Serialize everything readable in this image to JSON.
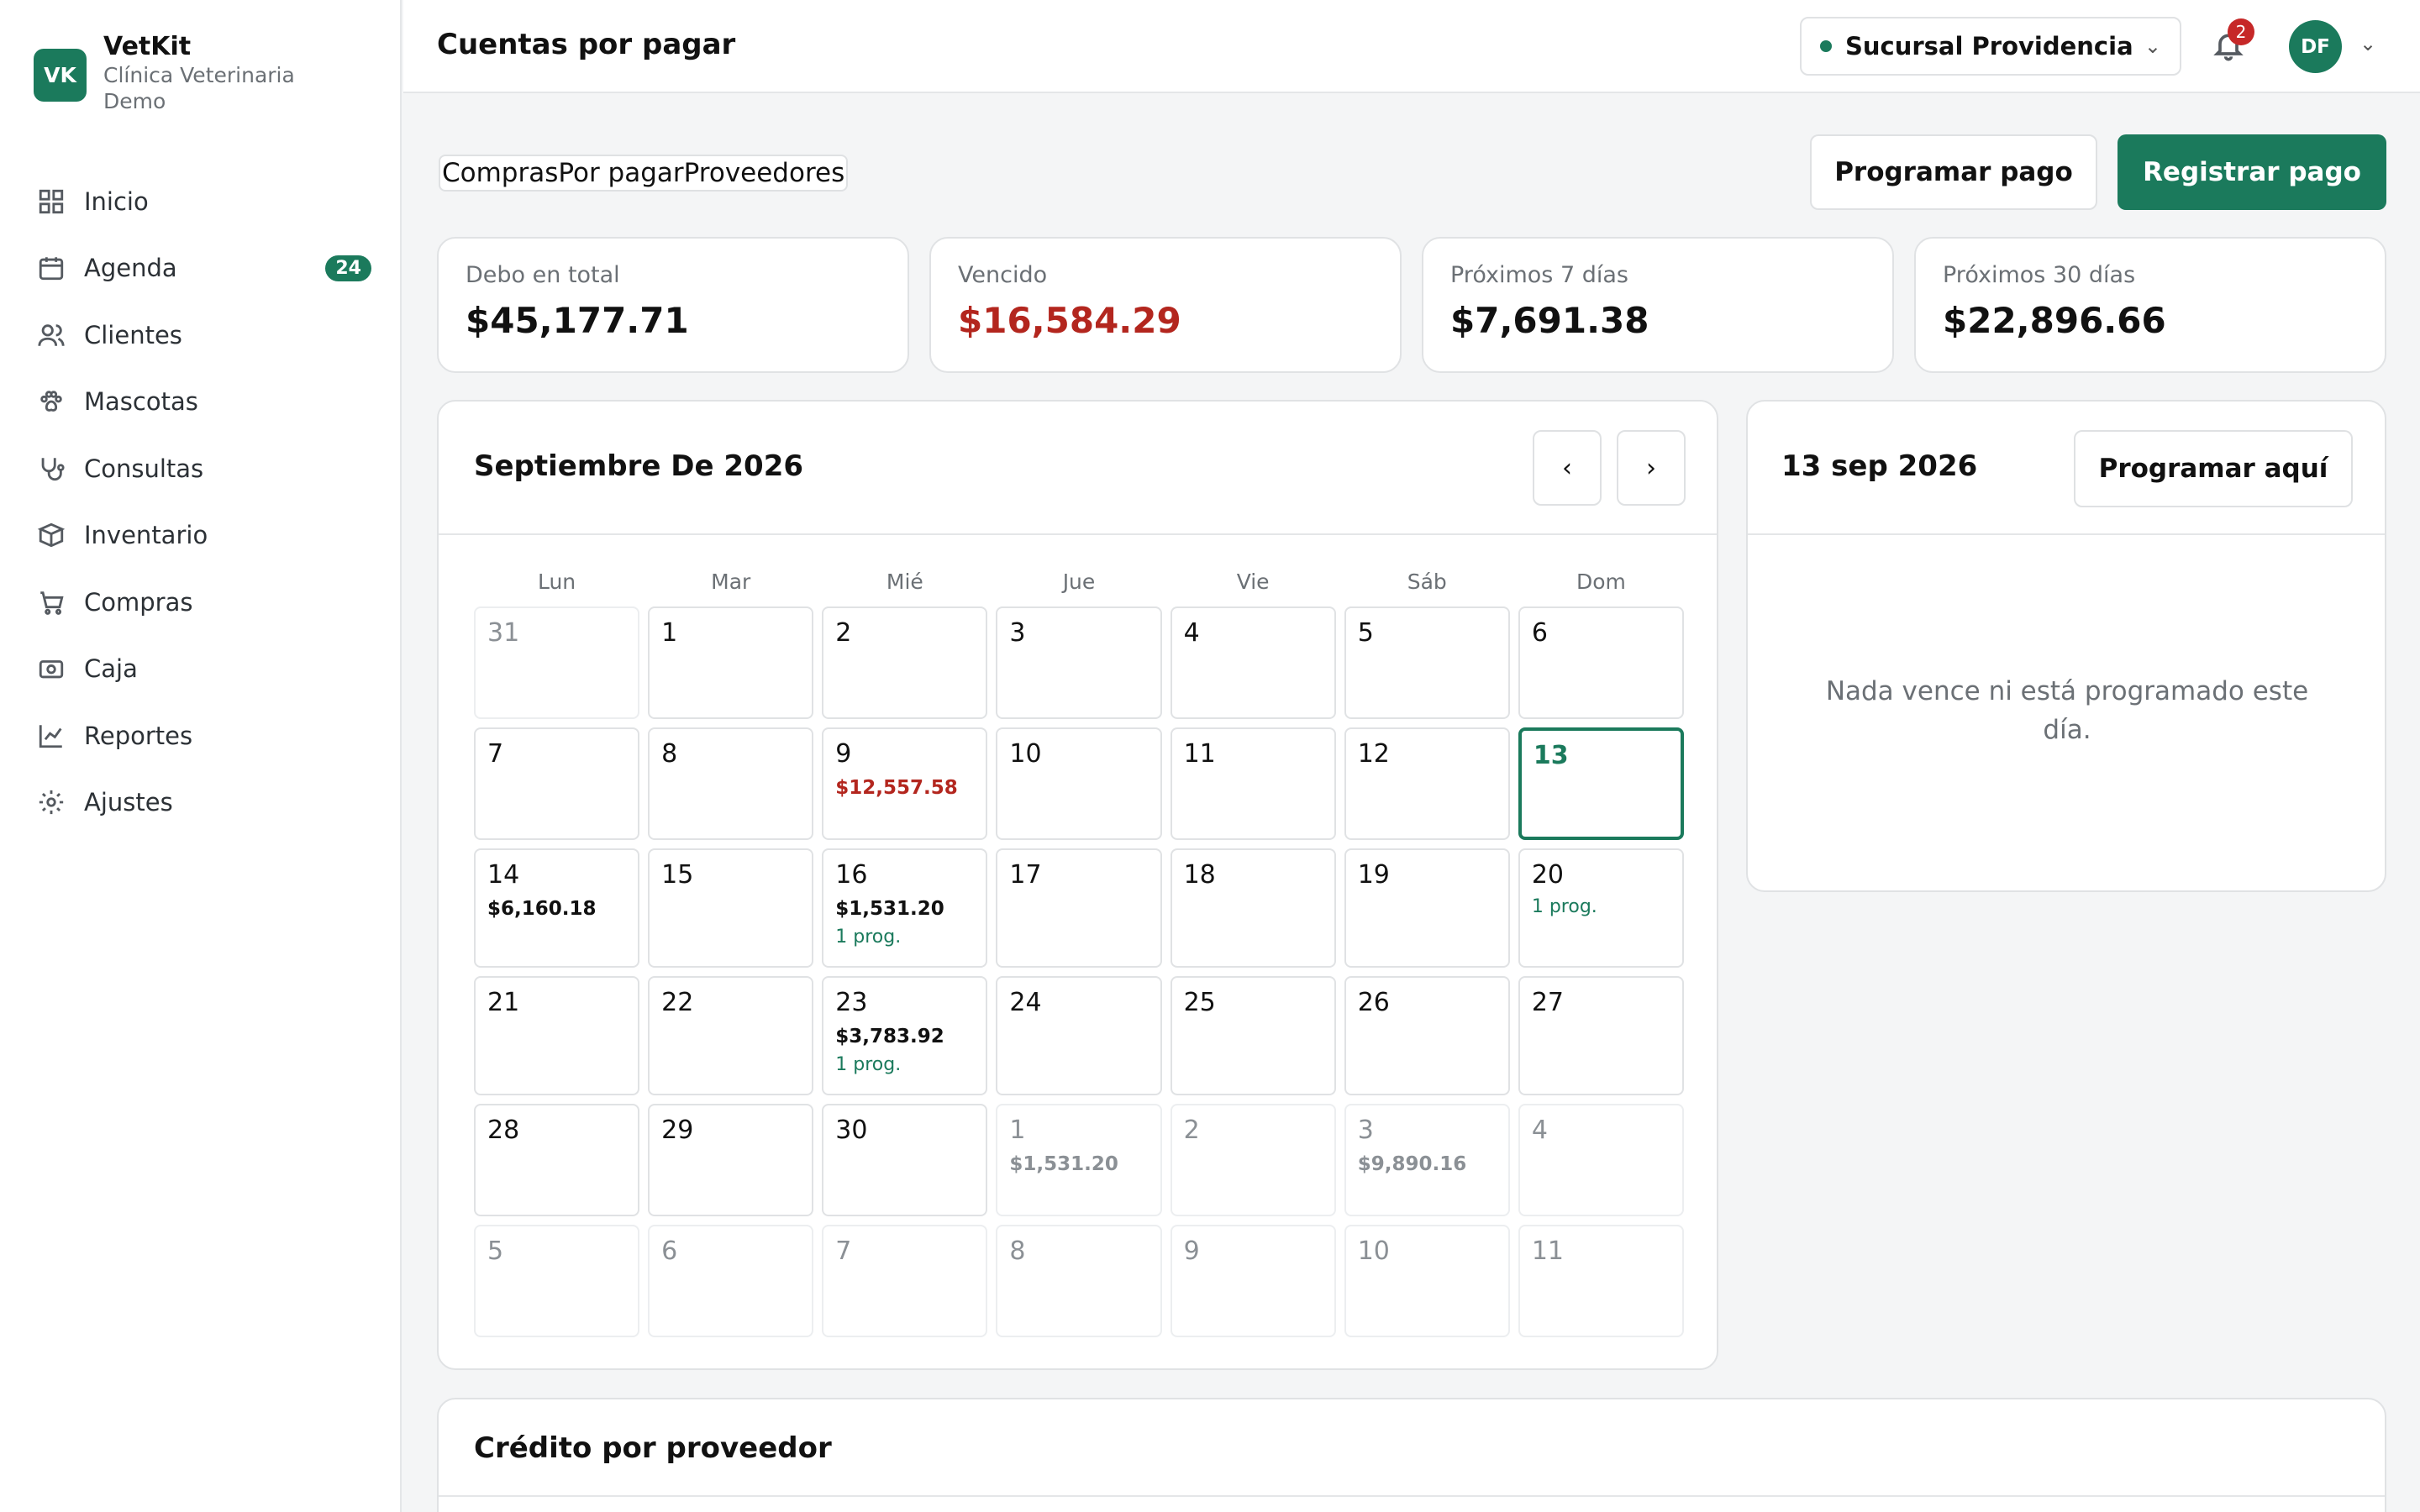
{
  "brand": {
    "logo": "VK",
    "name": "VetKit",
    "subtitle": "Clínica Veterinaria Demo"
  },
  "nav": [
    {
      "label": "Inicio",
      "icon": "grid-icon"
    },
    {
      "label": "Agenda",
      "icon": "calendar-icon",
      "badge": "24"
    },
    {
      "label": "Clientes",
      "icon": "users-icon"
    },
    {
      "label": "Mascotas",
      "icon": "paw-icon"
    },
    {
      "label": "Consultas",
      "icon": "stethoscope-icon"
    },
    {
      "label": "Inventario",
      "icon": "box-icon"
    },
    {
      "label": "Compras",
      "icon": "cart-icon"
    },
    {
      "label": "Caja",
      "icon": "cash-icon"
    },
    {
      "label": "Reportes",
      "icon": "chart-icon"
    },
    {
      "label": "Ajustes",
      "icon": "gear-icon"
    }
  ],
  "header": {
    "title": "Cuentas por pagar",
    "branch": "Sucursal Providencia",
    "notifications": "2",
    "avatar": "DF"
  },
  "tabs": [
    "Compras",
    "Por pagar",
    "Proveedores"
  ],
  "actions": {
    "schedule": "Programar pago",
    "register": "Registrar pago"
  },
  "stats": [
    {
      "label": "Debo en total",
      "value": "$45,177.71",
      "tone": "normal"
    },
    {
      "label": "Vencido",
      "value": "$16,584.29",
      "tone": "red"
    },
    {
      "label": "Próximos 7 días",
      "value": "$7,691.38",
      "tone": "normal"
    },
    {
      "label": "Próximos 30 días",
      "value": "$22,896.66",
      "tone": "normal"
    }
  ],
  "calendar": {
    "title": "Septiembre De 2026",
    "prev": "‹",
    "next": "›",
    "weekdays": [
      "Lun",
      "Mar",
      "Mié",
      "Jue",
      "Vie",
      "Sáb",
      "Dom"
    ],
    "weeks": [
      [
        {
          "d": "31",
          "other": true
        },
        {
          "d": "1"
        },
        {
          "d": "2"
        },
        {
          "d": "3"
        },
        {
          "d": "4"
        },
        {
          "d": "5"
        },
        {
          "d": "6"
        }
      ],
      [
        {
          "d": "7"
        },
        {
          "d": "8"
        },
        {
          "d": "9",
          "amount": "$12,557.58",
          "overdue": true
        },
        {
          "d": "10"
        },
        {
          "d": "11"
        },
        {
          "d": "12"
        },
        {
          "d": "13",
          "today": true
        }
      ],
      [
        {
          "d": "14",
          "amount": "$6,160.18"
        },
        {
          "d": "15"
        },
        {
          "d": "16",
          "amount": "$1,531.20",
          "prog": "1 prog."
        },
        {
          "d": "17"
        },
        {
          "d": "18"
        },
        {
          "d": "19"
        },
        {
          "d": "20",
          "prog": "1 prog."
        }
      ],
      [
        {
          "d": "21"
        },
        {
          "d": "22"
        },
        {
          "d": "23",
          "amount": "$3,783.92",
          "prog": "1 prog."
        },
        {
          "d": "24"
        },
        {
          "d": "25"
        },
        {
          "d": "26"
        },
        {
          "d": "27"
        }
      ],
      [
        {
          "d": "28"
        },
        {
          "d": "29"
        },
        {
          "d": "30"
        },
        {
          "d": "1",
          "other": true,
          "amount": "$1,531.20"
        },
        {
          "d": "2",
          "other": true
        },
        {
          "d": "3",
          "other": true,
          "amount": "$9,890.16"
        },
        {
          "d": "4",
          "other": true
        }
      ],
      [
        {
          "d": "5",
          "other": true
        },
        {
          "d": "6",
          "other": true
        },
        {
          "d": "7",
          "other": true
        },
        {
          "d": "8",
          "other": true
        },
        {
          "d": "9",
          "other": true
        },
        {
          "d": "10",
          "other": true
        },
        {
          "d": "11",
          "other": true
        }
      ]
    ]
  },
  "day_panel": {
    "title": "13 sep 2026",
    "button": "Programar aquí",
    "empty": "Nada vence ni está programado este día."
  },
  "credit": {
    "title": "Crédito por proveedor"
  },
  "colors": {
    "accent": "#1b7a5c",
    "danger": "#b3261e"
  }
}
